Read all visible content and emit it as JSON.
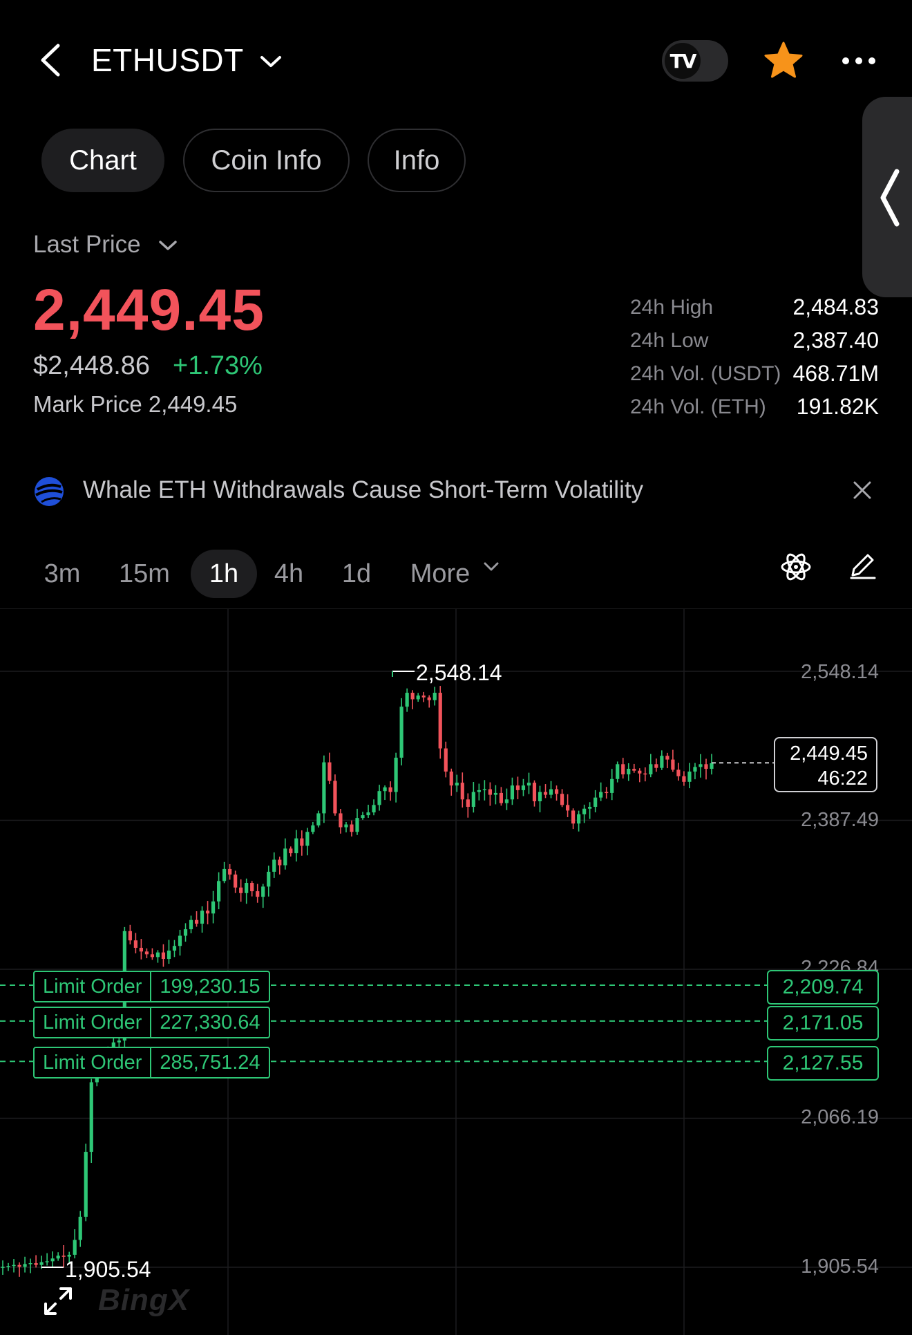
{
  "header": {
    "symbol": "ETHUSDT",
    "tv_label": "TV"
  },
  "tabs": [
    {
      "label": "Chart",
      "active": true
    },
    {
      "label": "Coin Info",
      "active": false
    },
    {
      "label": "Info",
      "active": false
    }
  ],
  "price_section": {
    "selector_label": "Last Price",
    "last_price": "2,449.45",
    "usd_price": "$2,448.86",
    "change_pct": "+1.73%",
    "mark_price_text": "Mark Price 2,449.45"
  },
  "stats": [
    {
      "label": "24h High",
      "value": "2,484.83"
    },
    {
      "label": "24h Low",
      "value": "2,387.40"
    },
    {
      "label": "24h Vol. (USDT)",
      "value": "468.71M"
    },
    {
      "label": "24h Vol. (ETH)",
      "value": "191.82K"
    }
  ],
  "news": {
    "headline": "Whale ETH Withdrawals Cause Short-Term Volatility"
  },
  "timeframes": [
    {
      "label": "3m",
      "active": false
    },
    {
      "label": "15m",
      "active": false
    },
    {
      "label": "1h",
      "active": true
    },
    {
      "label": "4h",
      "active": false
    },
    {
      "label": "1d",
      "active": false
    }
  ],
  "more_label": "More",
  "chart": {
    "axis_labels": [
      "2,548.14",
      "2,387.49",
      "2,226.84",
      "2,066.19",
      "1,905.54"
    ],
    "high_annotation": "2,548.14",
    "low_annotation": "1,905.54",
    "current_price": "2,449.45",
    "countdown": "46:22",
    "limit_orders": [
      {
        "label": "Limit Order",
        "amount": "199,230.15",
        "price": "2,209.74"
      },
      {
        "label": "Limit Order",
        "amount": "227,330.64",
        "price": "2,171.05"
      },
      {
        "label": "Limit Order",
        "amount": "285,751.24",
        "price": "2,127.55"
      }
    ],
    "watermark": "BingX",
    "colors": {
      "up": "#2ec776",
      "down": "#f2535b"
    }
  },
  "chart_data": {
    "type": "candlestick",
    "interval": "1h",
    "ylim": [
      1905.54,
      2548.14
    ],
    "y_ticks": [
      2548.14,
      2387.49,
      2226.84,
      2066.19,
      1905.54
    ],
    "max": 2548.14,
    "min": 1905.54,
    "last": 2449.45,
    "limit_order_prices": [
      2209.74,
      2171.05,
      2127.55
    ],
    "close_series": [
      1906,
      1907,
      1908,
      1906,
      1909,
      1910,
      1908,
      1911,
      1912,
      1915,
      1918,
      1917,
      1919,
      1935,
      1960,
      2030,
      2105,
      2120,
      2130,
      2140,
      2148,
      2150,
      2268,
      2258,
      2250,
      2246,
      2243,
      2240,
      2245,
      2238,
      2247,
      2252,
      2263,
      2270,
      2280,
      2276,
      2290,
      2287,
      2300,
      2322,
      2335,
      2329,
      2315,
      2309,
      2320,
      2311,
      2305,
      2316,
      2332,
      2345,
      2339,
      2357,
      2352,
      2368,
      2360,
      2375,
      2382,
      2395,
      2450,
      2430,
      2395,
      2380,
      2383,
      2375,
      2390,
      2393,
      2396,
      2404,
      2419,
      2423,
      2418,
      2455,
      2510,
      2525,
      2518,
      2522,
      2520,
      2517,
      2525,
      2465,
      2440,
      2425,
      2428,
      2410,
      2402,
      2418,
      2420,
      2421,
      2415,
      2417,
      2406,
      2410,
      2425,
      2420,
      2425,
      2428,
      2408,
      2418,
      2415,
      2421,
      2416,
      2404,
      2398,
      2384,
      2394,
      2400,
      2402,
      2412,
      2418,
      2417,
      2432,
      2448,
      2437,
      2443,
      2441,
      2438,
      2437,
      2448,
      2444,
      2457,
      2453,
      2442,
      2435,
      2429,
      2440,
      2445,
      2448,
      2443,
      2449
    ]
  }
}
